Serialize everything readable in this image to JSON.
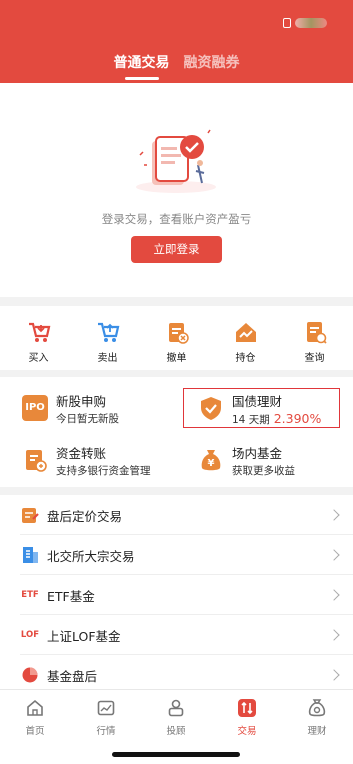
{
  "colors": {
    "brand": "#e34a3f",
    "highlight_border": "#e0363a"
  },
  "header": {
    "tabs": [
      {
        "label": "普通交易",
        "active": true
      },
      {
        "label": "融资融券",
        "active": false
      }
    ]
  },
  "login": {
    "prompt": "登录交易，查看账户资产盈亏",
    "button": "立即登录"
  },
  "quick_actions": [
    {
      "label": "买入",
      "icon": "cart-in-icon"
    },
    {
      "label": "卖出",
      "icon": "cart-out-icon"
    },
    {
      "label": "撤单",
      "icon": "cancel-order-icon"
    },
    {
      "label": "持仓",
      "icon": "holdings-icon"
    },
    {
      "label": "查询",
      "icon": "query-icon"
    }
  ],
  "features": [
    {
      "title": "新股申购",
      "subtitle": "今日暂无新股",
      "icon": "ipo-icon",
      "icon_text": "IPO"
    },
    {
      "title": "国债理财",
      "subtitle": "14 天期",
      "rate": "2.390%",
      "icon": "shield-check-icon"
    },
    {
      "title": "资金转账",
      "subtitle": "支持多银行资金管理",
      "icon": "transfer-icon"
    },
    {
      "title": "场内基金",
      "subtitle": "获取更多收益",
      "icon": "money-bag-icon",
      "icon_text": "¥"
    }
  ],
  "list": [
    {
      "label": "盘后定价交易",
      "icon": "after-hours-icon"
    },
    {
      "label": "北交所大宗交易",
      "icon": "building-icon"
    },
    {
      "label": "ETF基金",
      "icon": "etf-icon",
      "icon_text": "ETF"
    },
    {
      "label": "上证LOF基金",
      "icon": "lof-icon",
      "icon_text": "LOF"
    },
    {
      "label": "基金盘后",
      "icon": "pie-icon"
    }
  ],
  "tabbar": [
    {
      "label": "首页",
      "icon": "home-icon",
      "active": false
    },
    {
      "label": "行情",
      "icon": "chart-icon",
      "active": false
    },
    {
      "label": "投顾",
      "icon": "advisor-icon",
      "active": false
    },
    {
      "label": "交易",
      "icon": "trade-icon",
      "active": true
    },
    {
      "label": "理财",
      "icon": "wealth-icon",
      "active": false
    }
  ]
}
